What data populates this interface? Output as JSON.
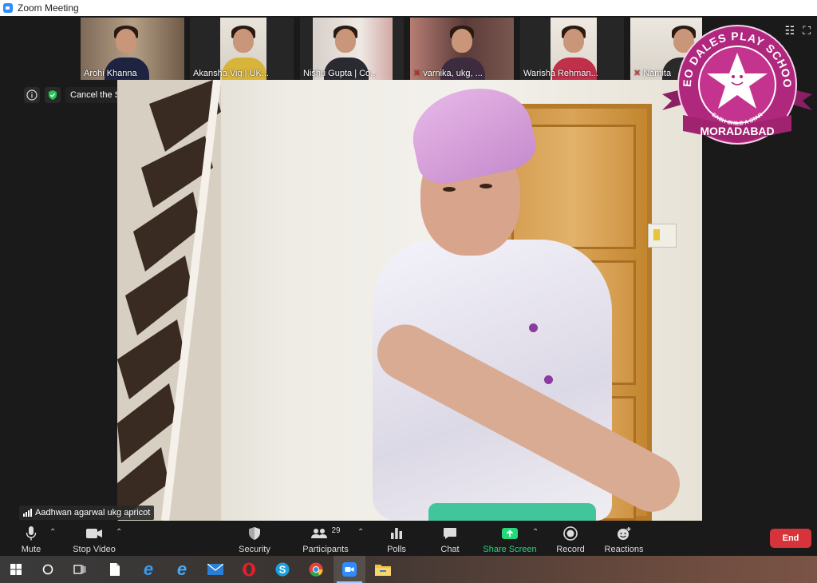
{
  "window": {
    "title": "Zoom Meeting"
  },
  "participants": [
    {
      "name": "Arohi Khanna",
      "muted": false
    },
    {
      "name": "Akansha Vig | UK...",
      "muted": false
    },
    {
      "name": "Nishu Gupta | Co...",
      "muted": false
    },
    {
      "name": "varnika, ukg, ...",
      "muted": true
    },
    {
      "name": "Warisha Rehman...",
      "muted": false
    },
    {
      "name": "Namita",
      "muted": true
    }
  ],
  "spotlight": {
    "cancel_label": "Cancel the Spotlight Video"
  },
  "main_video": {
    "speaker_name": "Aadhwan agarwal ukg apricot"
  },
  "logo": {
    "top_text": "NEO DALES PLAY SCHOOL",
    "tagline": "EACH CHILD A STAR",
    "city": "MORADABAD",
    "colors": {
      "ring": "#b0287e",
      "inner": "#c4348f",
      "star": "#ffffff"
    }
  },
  "toolbar": {
    "mute": "Mute",
    "stop_video": "Stop Video",
    "security": "Security",
    "participants": "Participants",
    "participants_count": "29",
    "polls": "Polls",
    "chat": "Chat",
    "share_screen": "Share Screen",
    "record": "Record",
    "reactions": "Reactions",
    "end": "End"
  },
  "colors": {
    "share_green": "#23d97a",
    "end_red": "#d6333a",
    "toolbar_bg": "#1a1a1a"
  },
  "taskbar": {
    "icons": [
      "windows-start-icon",
      "cortana-icon",
      "task-view-icon",
      "file-icon",
      "edge-legacy-icon",
      "internet-explorer-icon",
      "mail-icon",
      "opera-icon",
      "skype-icon",
      "chrome-icon",
      "zoom-icon",
      "file-explorer-icon"
    ]
  }
}
